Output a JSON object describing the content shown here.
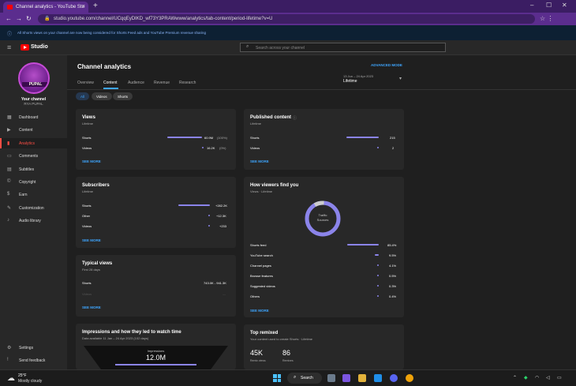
{
  "browser": {
    "tab_title": "Channel analytics - YouTube Stu",
    "url": "studio.youtube.com/channel/UCqqEyDIKD_wf73Y3PRAWwww/analytics/tab-content/period-lifetime?v=U",
    "new_tab": "+"
  },
  "notice": "All Shorts views on your channel are now being considered for Shorts Feed ads and YouTube Premium revenue sharing",
  "studio": {
    "logo_text": "Studio",
    "search_placeholder": "Search across your channel"
  },
  "sidebar": {
    "channel_label": "Your channel",
    "channel_name": "RYA PUPAL",
    "avatar_text": "PUPAL",
    "items": [
      {
        "label": "Dashboard",
        "icon": "dashboard-icon"
      },
      {
        "label": "Content",
        "icon": "content-icon"
      },
      {
        "label": "Analytics",
        "icon": "analytics-icon"
      },
      {
        "label": "Comments",
        "icon": "comments-icon"
      },
      {
        "label": "Subtitles",
        "icon": "subtitles-icon"
      },
      {
        "label": "Copyright",
        "icon": "copyright-icon"
      },
      {
        "label": "Earn",
        "icon": "earn-icon"
      },
      {
        "label": "Customization",
        "icon": "customization-icon"
      },
      {
        "label": "Audio library",
        "icon": "audio-library-icon"
      }
    ],
    "bottom_items": [
      {
        "label": "Settings",
        "icon": "gear-icon"
      },
      {
        "label": "Send feedback",
        "icon": "feedback-icon"
      }
    ]
  },
  "page": {
    "title": "Channel analytics",
    "advanced_mode": "ADVANCED MODE",
    "tabs": [
      "Overview",
      "Content",
      "Audience",
      "Revenue",
      "Research"
    ],
    "date_range": "13 Jun – 24 Apr 2023",
    "date_value": "Lifetime",
    "chips": [
      "All",
      "Videos",
      "Shorts"
    ]
  },
  "cards": {
    "views": {
      "title": "Views",
      "subtitle": "Lifetime",
      "rows": [
        {
          "label": "Shorts",
          "value": "60.9M",
          "pct": "(100%)"
        },
        {
          "label": "Videos",
          "value": "16.2K",
          "pct": "(0%)"
        }
      ],
      "see_more": "SEE MORE"
    },
    "published": {
      "title": "Published content",
      "subtitle": "Lifetime",
      "rows": [
        {
          "label": "Shorts",
          "value": "215"
        },
        {
          "label": "Videos",
          "value": "2"
        }
      ],
      "see_more": "SEE MORE"
    },
    "subscribers": {
      "title": "Subscribers",
      "subtitle": "Lifetime",
      "rows": [
        {
          "label": "Shorts",
          "value": "+282.2K"
        },
        {
          "label": "Other",
          "value": "+12.3K"
        },
        {
          "label": "Videos",
          "value": "+233"
        }
      ],
      "see_more": "SEE MORE"
    },
    "find": {
      "title": "How viewers find you",
      "subtitle": "Views · Lifetime",
      "donut_label_1": "Traffic",
      "donut_label_2": "Sources",
      "rows": [
        {
          "label": "Shorts feed",
          "value": "85.4%"
        },
        {
          "label": "YouTube search",
          "value": "9.5%"
        },
        {
          "label": "Channel pages",
          "value": "4.1%"
        },
        {
          "label": "Browse features",
          "value": "0.5%"
        },
        {
          "label": "Suggested videos",
          "value": "0.3%"
        },
        {
          "label": "Others",
          "value": "0.4%"
        }
      ],
      "see_more": "SEE MORE"
    },
    "typical": {
      "title": "Typical views",
      "subtitle": "First 28 days",
      "rows": [
        {
          "label": "Shorts",
          "value": "743.0K - 941.3K"
        },
        {
          "label": "Videos",
          "value": "—"
        }
      ],
      "see_more": "SEE MORE"
    },
    "impressions": {
      "title": "Impressions and how they led to watch time",
      "subtitle": "Data available 11 Jan – 24 Apr 2023 (102 days)",
      "label": "Impressions",
      "value": "12.0M"
    },
    "remixed": {
      "title": "Top remixed",
      "subtitle": "Your content used to create Shorts · Lifetime",
      "stat1_value": "45K",
      "stat1_label": "Remix views",
      "stat2_value": "86",
      "stat2_label": "Remixes"
    }
  },
  "taskbar": {
    "temp": "25°F",
    "weather": "Mostly cloudy",
    "search": "Search"
  },
  "colors": {
    "accent_blue": "#3ea6ff",
    "bar_purple": "#8b84ea",
    "active_red": "#ff4e45",
    "chrome_purple": "#5b2d8e"
  }
}
